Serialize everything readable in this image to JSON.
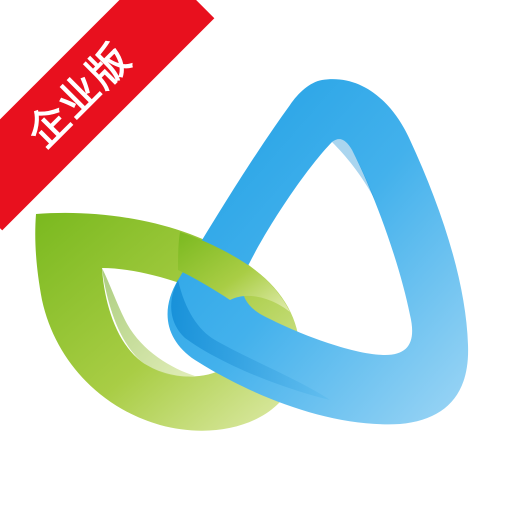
{
  "badge": {
    "label": "企业版",
    "color": "#e8101e",
    "text_color": "#ffffff"
  },
  "logo": {
    "shapes": [
      "green-leaf-ring",
      "blue-triangle-ring"
    ],
    "colors": {
      "green_dark": "#7ab91f",
      "green_light": "#dbe9a0",
      "blue_dark": "#0f8fd9",
      "blue_light": "#8ccdf3"
    }
  }
}
